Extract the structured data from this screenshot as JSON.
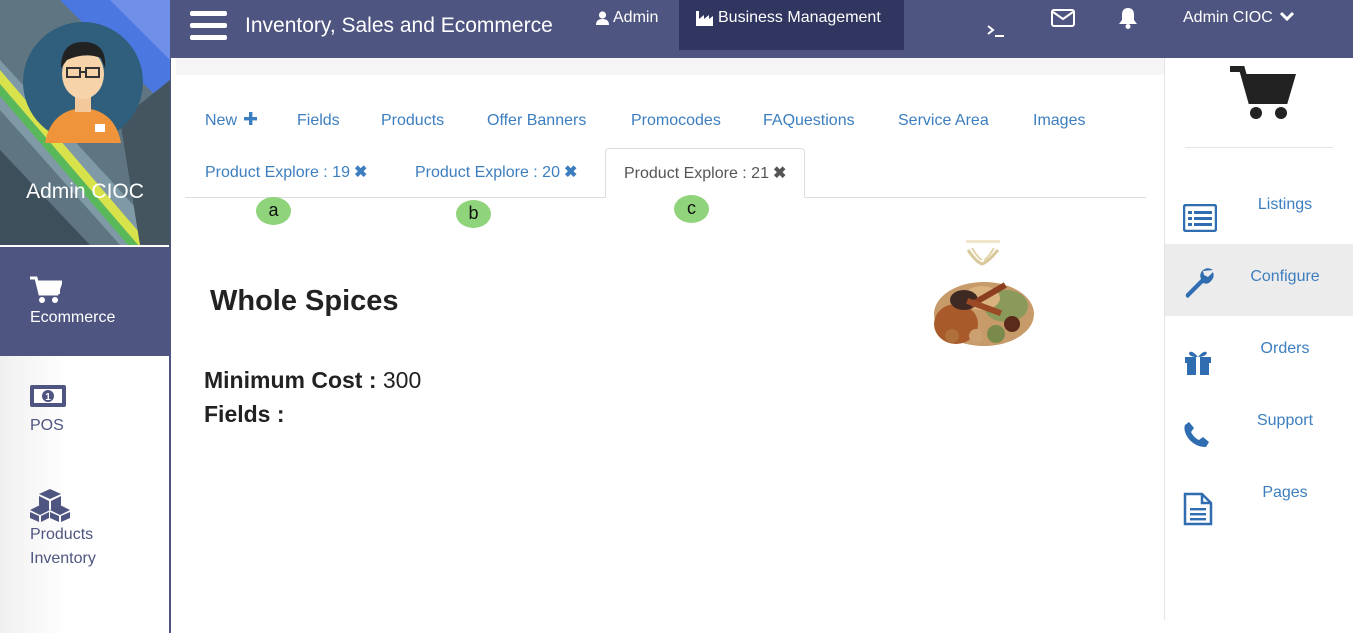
{
  "topbar": {
    "app_title": "Inventory, Sales and Ecommerce",
    "nav_admin": "Admin",
    "nav_business": "Business Management",
    "user_menu": "Admin CIOC",
    "icons": [
      "menu-icon",
      "user-icon",
      "industry-icon",
      "terminal-icon",
      "envelope-icon",
      "bell-icon",
      "chevron-down-icon"
    ]
  },
  "left_sidebar": {
    "profile_name": "Admin CIOC",
    "items": [
      {
        "label": "Ecommerce",
        "icon": "cart-icon",
        "active": true
      },
      {
        "label": "POS",
        "icon": "money-icon",
        "active": false
      },
      {
        "label": "Products Inventory",
        "icon": "cubes-icon",
        "active": false
      }
    ]
  },
  "tabs": {
    "row1": [
      "New",
      "Fields",
      "Products",
      "Offer Banners",
      "Promocodes",
      "FAQuestions",
      "Service Area",
      "Images"
    ],
    "row2": [
      {
        "label": "Product Explore : 19",
        "active": false
      },
      {
        "label": "Product Explore : 20",
        "active": false
      },
      {
        "label": "Product Explore : 21",
        "active": true
      }
    ],
    "markers": [
      "a",
      "b",
      "c"
    ]
  },
  "product": {
    "name": "Whole Spices",
    "min_cost_label": "Minimum Cost :",
    "min_cost_value": "300",
    "fields_label": "Fields :"
  },
  "right_sidebar": {
    "items": [
      {
        "label": "Listings",
        "icon": "list-icon",
        "active": false
      },
      {
        "label": "Configure",
        "icon": "wrench-icon",
        "active": true
      },
      {
        "label": "Orders",
        "icon": "gift-icon",
        "active": false
      },
      {
        "label": "Support",
        "icon": "phone-icon",
        "active": false
      },
      {
        "label": "Pages",
        "icon": "file-icon",
        "active": false
      }
    ]
  },
  "colors": {
    "primary": "#4e5580",
    "primary_dark": "#303660",
    "link": "#3c7ebf",
    "marker": "#8fd37a"
  }
}
